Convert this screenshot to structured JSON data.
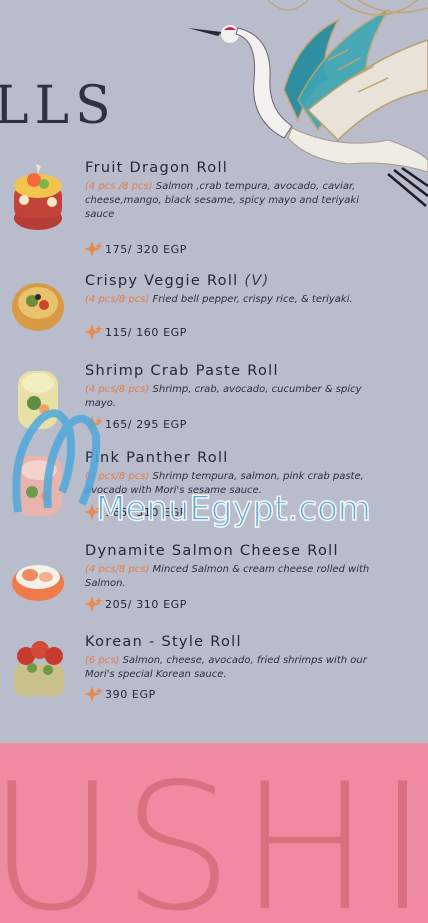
{
  "heading": "LLS",
  "bottom_banner": "USHI",
  "watermark": "MenuEgypt.com",
  "colors": {
    "background": "#b9bccb",
    "accent": "#e07c52",
    "pink": "#f08aa3"
  },
  "items": [
    {
      "name": "Fruit Dragon Roll",
      "tag": "",
      "qty": "(4 pcs /8 pcs)",
      "description": " Salmon ,crab tempura, avocado, caviar, cheese,mango, black sesame, spicy mayo and teriyaki sauce",
      "price": "175/ 320 EGP"
    },
    {
      "name": "Crispy Veggie Roll",
      "tag": "(V)",
      "qty": "(4 pcs/8 pcs)",
      "description": " Fried bell pepper, crispy rice, & teriyaki.",
      "price": "115/ 160 EGP"
    },
    {
      "name": "Shrimp Crab Paste Roll",
      "tag": "",
      "qty": "(4 pcs/8 pcs)",
      "description": " Shrimp, crab, avocado, cucumber & spicy mayo.",
      "price": "165/ 295 EGP"
    },
    {
      "name": "Pink Panther Roll",
      "tag": "",
      "qty": "(4 pcs/8 pcs)",
      "description": " Shrimp tempura, salmon, pink crab paste, avocado with Mori's sesame sauce.",
      "price": "165/ 310 EGP"
    },
    {
      "name": "Dynamite Salmon Cheese Roll",
      "tag": "",
      "qty": "(4 pcs/8 pcs)",
      "description": " Minced Salmon & cream cheese rolled with Salmon.",
      "price": "205/ 310 EGP"
    },
    {
      "name": "Korean - Style Roll",
      "tag": "",
      "qty": "(6 pcs)",
      "description": " Salmon, cheese, avocado, fried shrimps with our Mori's special Korean sauce.",
      "price": "390 EGP"
    }
  ]
}
